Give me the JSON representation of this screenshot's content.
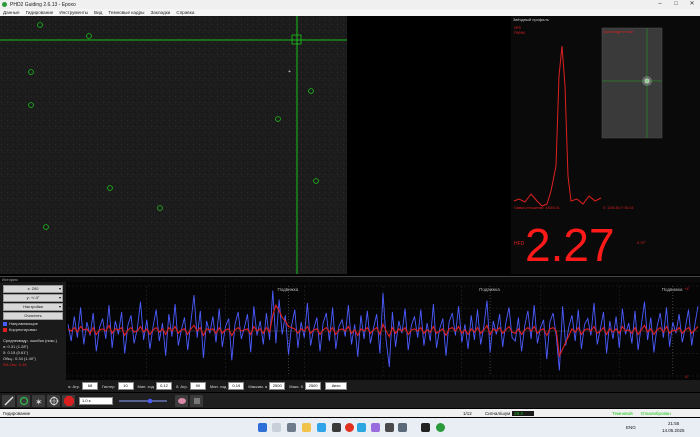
{
  "window": {
    "title": "PHD2 Guiding 2.6.13 - Ерохо"
  },
  "menu": [
    "Данные",
    "Гидирование",
    "Инструменты",
    "Вид",
    "Темновые кадры",
    "Закладки",
    "Справка"
  ],
  "profile": {
    "title": "Звёздный профиль",
    "left_labels": [
      "HFD",
      "FWHM"
    ],
    "inset_label": "Click image for star",
    "half_flux": "Гамма отношение: 3.63/0.01",
    "coords": "X: 1193.84 Y: 50.15",
    "hfd_label": "HFD",
    "hfd_value": "2.27",
    "hfd_unit": "0.37\""
  },
  "history": {
    "title": "История",
    "x_select": "x: 200",
    "y_select": "y: +/-4\"",
    "settings": "Настройки",
    "clear": "Очистить",
    "legend_ra": "Направляющие",
    "legend_dec": "Корректировки",
    "rms_title": "Среднеквадр. ошибка (пикс.)",
    "rms_ra": "α: 0.31 (1.28\")",
    "rms_dec": "δ: 0.15 (0.61\")",
    "rms_tot": "Общ.: 0.34 (1.40\")",
    "osc": "RA Osc: 0.46",
    "dither_label": "Подвижка",
    "y_top": "+4\"",
    "y_bot": "-4\""
  },
  "controls": [
    {
      "label": "α: Агр.",
      "value": "68"
    },
    {
      "label": "Гистер.",
      "value": "10"
    },
    {
      "label": "Мин. ход",
      "value": "0.12"
    },
    {
      "label": "δ: Агр.",
      "value": "90"
    },
    {
      "label": "Мин. ход",
      "value": "0.19"
    },
    {
      "label": "Максим. α",
      "value": "2500"
    },
    {
      "label": "Макс. δ",
      "value": "2500"
    },
    {
      "label": "",
      "value": "Авто"
    }
  ],
  "toolbar": {
    "exposure": "1.0 s"
  },
  "status": {
    "left": "Гидирование",
    "frame": "1/12",
    "snr_label": "Сигнал/шум",
    "snr_value": "28.3",
    "dark": "Темновой",
    "calib": "Откалиброван"
  },
  "taskbar": {
    "lang": "ENG",
    "time": "21:55",
    "date": "14.05.2025"
  },
  "colors": {
    "ra": "#4b5cff",
    "dec": "#e02020",
    "hfd": "#ff1a1a",
    "crosshair": "#19c419"
  },
  "chart_data": {
    "type": "line",
    "title": "",
    "xlabel": "",
    "ylabel": "",
    "ylim": [
      -4,
      4
    ],
    "x_points": 200,
    "grid": true,
    "legend": "left",
    "dither_markers": [
      0.35,
      0.67,
      0.96
    ],
    "series": [
      {
        "name": "Направляющие",
        "values": [
          0.6,
          -0.9,
          1.3,
          -0.6,
          2.1,
          -1.2,
          0.8,
          -0.4,
          1.6,
          -1.8,
          0.3,
          1.1,
          -0.7,
          2.3,
          -1.5,
          0.9,
          -0.3,
          1.7,
          -2.0,
          0.5,
          1.4,
          -1.1,
          0.2,
          2.6,
          -0.8,
          1.0,
          -1.6,
          0.4,
          1.9,
          -0.9,
          0.7,
          -2.2,
          1.5,
          -0.5,
          2.4,
          -1.3,
          0.1,
          1.2,
          -1.7,
          0.8,
          3.2,
          -0.6,
          1.8,
          -2.4,
          0.9,
          -0.2,
          1.3,
          -1.0,
          2.0,
          -1.4,
          0.4,
          1.1,
          -2.6,
          0.6,
          1.7,
          -0.7,
          0.3,
          1.5,
          -1.9,
          2.2,
          -0.4,
          0.9,
          -1.2,
          1.6,
          -0.8,
          3.6,
          -1.1,
          2.8,
          -0.3,
          1.4,
          -2.1,
          0.5,
          1.9,
          -1.5,
          0.8,
          -0.6,
          2.5,
          -1.3,
          0.2,
          1.2,
          -1.8,
          0.7,
          1.6,
          -0.9,
          2.1,
          -1.6,
          0.4,
          1.0,
          -0.5,
          2.3,
          -1.2,
          0.6,
          -2.3,
          1.4,
          -0.7,
          1.8,
          -1.1,
          0.3,
          1.5,
          -2.0,
          3.4,
          -0.8,
          -3.2,
          1.7,
          -1.4,
          0.9,
          -0.2,
          2.0,
          -1.7,
          0.5,
          1.3,
          -0.6,
          1.9,
          -1.3,
          0.7,
          -0.9,
          2.4,
          -1.5,
          0.2,
          1.1,
          -2.2,
          0.8,
          1.6,
          -0.4,
          2.2,
          -1.0,
          0.6,
          -1.6,
          1.4,
          -0.8,
          1.9,
          -1.2,
          0.4,
          2.7,
          -1.9,
          0.9,
          -0.3,
          1.5,
          -1.4,
          0.7,
          2.1,
          -0.6,
          -0.9,
          1.2,
          -1.8,
          0.5,
          1.8,
          -0.7,
          2.3,
          -1.1,
          0.3,
          1.0,
          -2.5,
          0.8,
          1.6,
          -0.5,
          -3.5,
          2.2,
          -1.3,
          0.4,
          1.4,
          -0.9,
          1.9,
          -1.6,
          0.6,
          1.1,
          -0.4,
          2.5,
          -1.2,
          0.2,
          1.7,
          -2.0,
          0.9,
          -0.7,
          1.3,
          -1.5,
          2.0,
          -0.3,
          0.7,
          -1.1,
          1.8,
          -1.7,
          0.5,
          2.6,
          -0.8,
          1.2,
          -1.9,
          0.4,
          1.6,
          -0.6,
          2.1,
          -1.4,
          0.8,
          -0.2,
          1.5,
          -1.0,
          0.3,
          1.9,
          -1.3,
          0.6,
          2.2
        ]
      },
      {
        "name": "Корректировки",
        "values": [
          0.2,
          0.0,
          0.3,
          -0.1,
          0.4,
          0.1,
          0.2,
          -0.2,
          0.3,
          -0.3,
          0.1,
          0.2,
          0.0,
          0.5,
          -0.2,
          0.2,
          0.1,
          0.3,
          -0.4,
          0.1,
          0.3,
          -0.1,
          0.0,
          0.4,
          -0.1,
          0.2,
          -0.3,
          0.1,
          0.3,
          -0.1,
          0.2,
          -0.3,
          0.3,
          0.0,
          0.4,
          -0.2,
          0.1,
          0.2,
          -0.3,
          0.2,
          0.5,
          0.0,
          0.3,
          -0.4,
          0.2,
          0.1,
          0.2,
          -0.2,
          0.3,
          -0.2,
          0.1,
          0.2,
          -0.4,
          0.1,
          0.3,
          0.0,
          0.1,
          0.2,
          -0.3,
          0.4,
          0.0,
          0.2,
          -0.2,
          0.3,
          -0.1,
          1.4,
          2.3,
          1.8,
          1.2,
          0.9,
          0.4,
          0.3,
          0.2,
          -0.2,
          0.2,
          0.0,
          0.4,
          -0.2,
          0.1,
          0.2,
          -0.3,
          0.1,
          0.3,
          -0.1,
          0.3,
          -0.3,
          0.1,
          0.2,
          0.0,
          0.4,
          -0.2,
          0.1,
          -0.4,
          0.2,
          0.0,
          0.3,
          -0.2,
          0.1,
          0.3,
          -0.3,
          0.6,
          0.0,
          -0.5,
          0.3,
          -0.2,
          0.2,
          0.0,
          0.3,
          -0.3,
          0.1,
          0.2,
          0.0,
          0.3,
          -0.2,
          0.1,
          -0.1,
          0.4,
          -0.2,
          0.0,
          0.2,
          -0.4,
          0.2,
          0.3,
          0.0,
          0.4,
          -0.2,
          0.1,
          -0.3,
          0.2,
          -0.1,
          0.3,
          -0.2,
          0.1,
          0.5,
          -0.3,
          0.2,
          0.0,
          0.3,
          -0.2,
          0.1,
          0.4,
          -0.1,
          -0.2,
          0.2,
          -0.3,
          0.1,
          0.3,
          0.0,
          0.4,
          -0.2,
          0.1,
          0.2,
          -0.4,
          0.2,
          0.3,
          0.0,
          -2.2,
          -1.6,
          -1.0,
          -0.4,
          0.2,
          -0.1,
          0.3,
          -0.3,
          0.1,
          0.2,
          0.0,
          0.4,
          -0.2,
          0.0,
          0.3,
          -0.3,
          0.2,
          -0.1,
          0.2,
          -0.2,
          0.4,
          0.0,
          0.1,
          -0.2,
          0.3,
          -0.3,
          0.1,
          0.5,
          -0.1,
          0.2,
          -0.3,
          0.1,
          0.3,
          -0.1,
          0.4,
          -0.2,
          0.1,
          0.0,
          0.3,
          -0.2,
          0.1,
          0.3,
          -0.2,
          0.1,
          0.4
        ]
      }
    ]
  }
}
